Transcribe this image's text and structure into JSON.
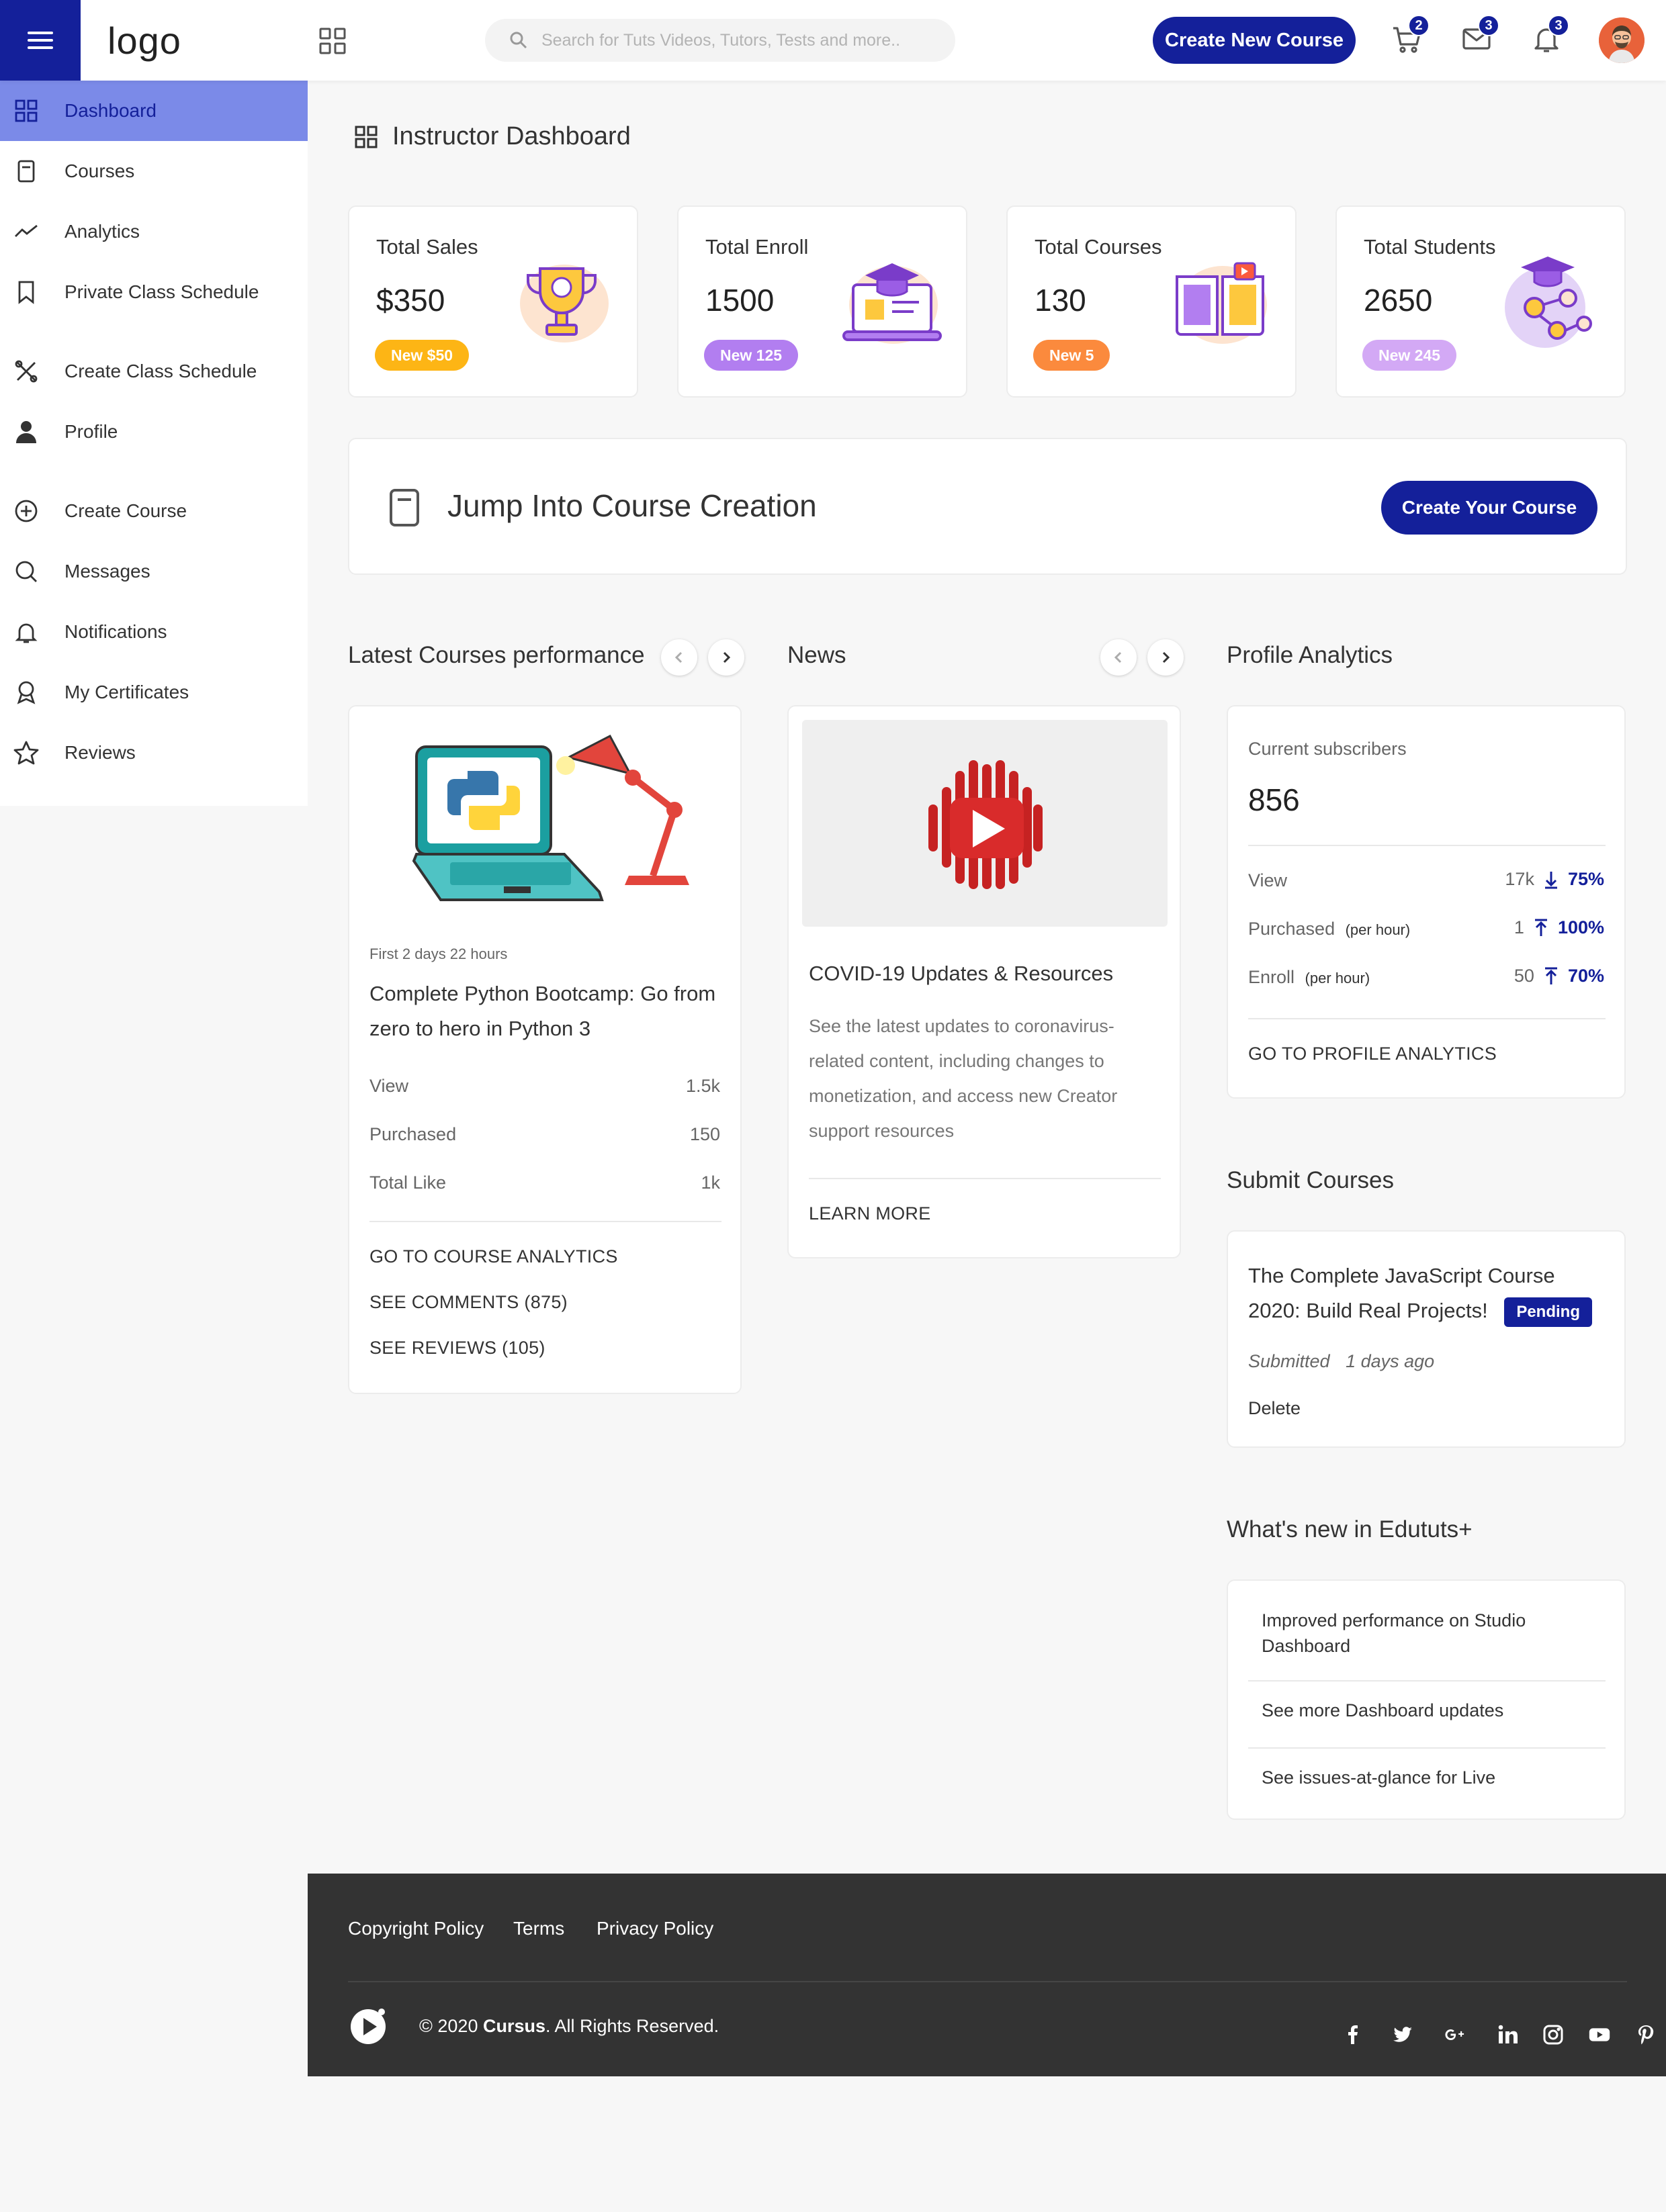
{
  "header": {
    "logo": "logo",
    "search_placeholder": "Search for Tuts Videos, Tutors, Tests and more..",
    "create_button": "Create New Course",
    "cart_count": "2",
    "messages_count": "3",
    "notifications_count": "3"
  },
  "sidebar": {
    "items": [
      {
        "label": "Dashboard",
        "icon": "dashboard-icon"
      },
      {
        "label": "Courses",
        "icon": "book-icon"
      },
      {
        "label": "Analytics",
        "icon": "trend-icon"
      },
      {
        "label": "Private Class Schedule",
        "icon": "bookmark-icon"
      },
      {
        "label": "Create Class Schedule",
        "icon": "tools-icon"
      },
      {
        "label": "Profile",
        "icon": "user-icon"
      },
      {
        "label": "Create Course",
        "icon": "plus-circle-icon"
      },
      {
        "label": "Messages",
        "icon": "chat-icon"
      },
      {
        "label": "Notifications",
        "icon": "bell-icon"
      },
      {
        "label": "My Certificates",
        "icon": "award-icon"
      },
      {
        "label": "Reviews",
        "icon": "star-icon"
      }
    ]
  },
  "page": {
    "title": "Instructor Dashboard"
  },
  "stats": [
    {
      "title": "Total Sales",
      "value": "$350",
      "badge": "New $50",
      "badge_color": "#fdb515"
    },
    {
      "title": "Total Enroll",
      "value": "1500",
      "badge": "New 125",
      "badge_color": "#b27ef0"
    },
    {
      "title": "Total Courses",
      "value": "130",
      "badge": "New 5",
      "badge_color": "#fb8a3d"
    },
    {
      "title": "Total Students",
      "value": "2650",
      "badge": "New 245",
      "badge_color": "#d3a9f5"
    }
  ],
  "jump": {
    "title": "Jump Into Course Creation",
    "button": "Create Your Course"
  },
  "latest": {
    "section_title": "Latest Courses performance",
    "meta": "First 2 days 22 hours",
    "course_title": "Complete Python Bootcamp: Go from zero to hero in Python 3",
    "rows": [
      {
        "label": "View",
        "value": "1.5k"
      },
      {
        "label": "Purchased",
        "value": "150"
      },
      {
        "label": "Total Like",
        "value": "1k"
      }
    ],
    "links": [
      "GO TO COURSE ANALYTICS",
      "SEE COMMENTS (875)",
      "SEE REVIEWS (105)"
    ]
  },
  "news": {
    "section_title": "News",
    "title": "COVID-19 Updates & Resources",
    "body": "See the latest updates to coronavirus-related content, including changes to monetization, and access new Creator support resources",
    "link": "LEARN MORE"
  },
  "profile_analytics": {
    "section_title": "Profile Analytics",
    "subscribers_label": "Current subscribers",
    "subscribers_value": "856",
    "rows": [
      {
        "label": "View",
        "suffix": "",
        "value": "17k",
        "percent": "75%",
        "direction": "down"
      },
      {
        "label": "Purchased",
        "suffix": "(per hour)",
        "value": "1",
        "percent": "100%",
        "direction": "up"
      },
      {
        "label": "Enroll",
        "suffix": "(per hour)",
        "value": "50",
        "percent": "70%",
        "direction": "up"
      }
    ],
    "link": "GO TO PROFILE ANALYTICS"
  },
  "submit": {
    "section_title": "Submit Courses",
    "course_title": "The Complete JavaScript Course 2020: Build Real Projects!",
    "status": "Pending",
    "submitted_label": "Submitted",
    "submitted_time": "1 days ago",
    "delete": "Delete"
  },
  "whats_new": {
    "section_title": "What's new in Edututs+",
    "items": [
      "Improved performance on Studio Dashboard",
      "See more Dashboard updates",
      "See issues-at-glance for Live"
    ]
  },
  "footer": {
    "links": [
      "Copyright Policy",
      "Terms",
      "Privacy Policy"
    ],
    "copyright_prefix": "© 2020 ",
    "copyright_brand": "Cursus",
    "copyright_suffix": ". All Rights Reserved.",
    "social": [
      "facebook-icon",
      "twitter-icon",
      "google-plus-icon",
      "linkedin-icon",
      "instagram-icon",
      "youtube-icon",
      "pinterest-icon"
    ]
  },
  "colors": {
    "primary": "#14209a",
    "active_nav": "#7b8ae8",
    "footer": "#333333"
  }
}
